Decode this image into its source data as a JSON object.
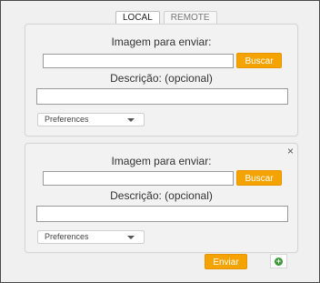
{
  "tabs": [
    {
      "label": "LOCAL",
      "active": true
    },
    {
      "label": "REMOTE",
      "active": false
    }
  ],
  "panels": [
    {
      "image_label": "Imagem para enviar:",
      "file_value": "",
      "buscar_label": "Buscar",
      "description_label": "Descrição: (opcional)",
      "description_value": "",
      "preferences_label": "Preferences"
    },
    {
      "close_glyph": "×",
      "image_label": "Imagem para enviar:",
      "file_value": "",
      "buscar_label": "Buscar",
      "description_label": "Descrição: (opcional)",
      "description_value": "",
      "preferences_label": "Preferences"
    }
  ],
  "actions": {
    "enviar_label": "Enviar",
    "add_glyph": "+"
  },
  "colors": {
    "accent": "#f5a300",
    "add_icon": "#3a9a37"
  }
}
